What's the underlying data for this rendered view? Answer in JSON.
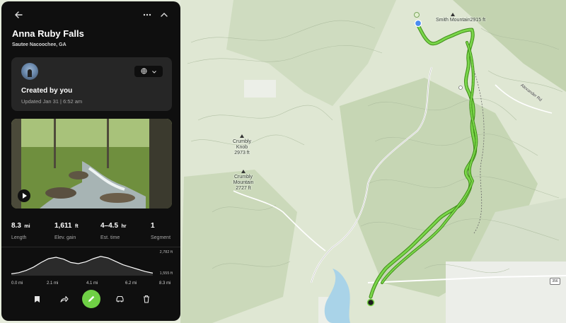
{
  "trail": {
    "title": "Anna Ruby Falls",
    "location": "Sautee Nacoochee, GA"
  },
  "creator": {
    "created_label": "Created by you",
    "updated": "Updated Jan 31 | 6:52 am"
  },
  "stats": [
    {
      "value": "8.3",
      "unit": "mi",
      "label": "Length"
    },
    {
      "value": "1,611",
      "unit": "ft",
      "label": "Elev. gain"
    },
    {
      "value": "4–4.5",
      "unit": "hr",
      "label": "Est. time"
    },
    {
      "value": "1",
      "unit": "",
      "label": "Segment"
    }
  ],
  "elevation": {
    "max_label": "2,782 ft",
    "min_label": "1,555 ft",
    "x_labels": [
      "0.0 mi",
      "2.1 mi",
      "4.1 mi",
      "6.2 mi",
      "8.3 mi"
    ],
    "profile": [
      0.05,
      0.1,
      0.2,
      0.35,
      0.55,
      0.72,
      0.78,
      0.7,
      0.55,
      0.5,
      0.58,
      0.72,
      0.82,
      0.75,
      0.6,
      0.45,
      0.35,
      0.25,
      0.15,
      0.08
    ]
  },
  "map": {
    "labels": [
      {
        "id": "smith",
        "name": "Smith Mountain",
        "elev": "2915 ft"
      },
      {
        "id": "crumbly-knob",
        "name": "Crumbly Knob",
        "elev": "2973 ft"
      },
      {
        "id": "crumbly-mtn",
        "name": "Crumbly Mountain",
        "elev": "2727 ft"
      }
    ],
    "road_label": "Alexander Rd",
    "highway_shield": "356",
    "trail_color": "#5fc12a",
    "water_color": "#a9d3e8"
  },
  "icons": {
    "back": "arrow-left-icon",
    "more": "more-icon",
    "collapse": "chevron-up-icon",
    "visibility": "globe-icon",
    "play": "play-icon",
    "save": "bookmark-icon",
    "share": "share-icon",
    "edit": "pencil-icon",
    "drive": "car-icon",
    "delete": "trash-icon"
  },
  "colors": {
    "panel_bg": "#0f0f0f",
    "card_bg": "#262626",
    "accent": "#6fd045"
  }
}
